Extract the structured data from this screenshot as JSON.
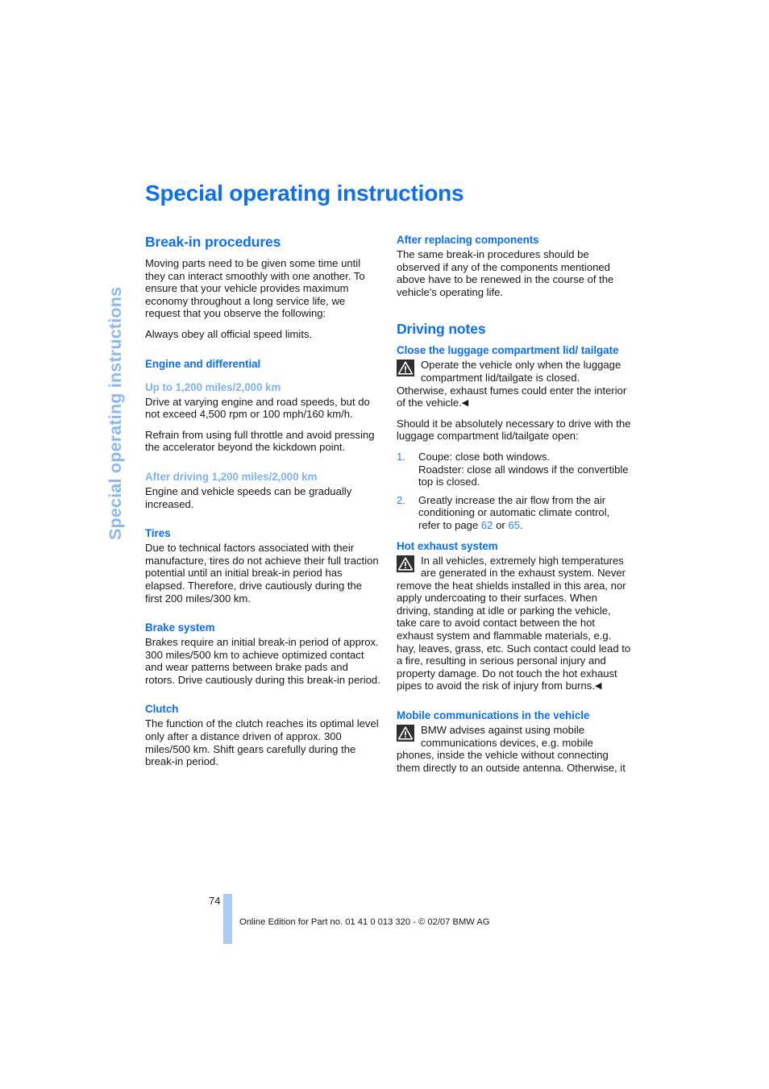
{
  "sidebar": {
    "chapter_label": "Special operating instructions"
  },
  "header": {
    "title": "Special operating instructions"
  },
  "left_column": {
    "section_title": "Break-in procedures",
    "intro_paragraph": "Moving parts need to be given some time until they can interact smoothly with one another. To ensure that your vehicle provides maximum economy throughout a long service life, we request that you observe the following:",
    "speed_limits_paragraph": "Always obey all official speed limits.",
    "engine_heading": "Engine and differential",
    "upto_heading": "Up to 1,200 miles/2,000 km",
    "upto_paragraph_1": "Drive at varying engine and road speeds, but do not exceed 4,500 rpm or 100 mph/160 km/h.",
    "upto_paragraph_2": "Refrain from using full throttle and avoid pressing the accelerator beyond the kickdown point.",
    "after_heading": "After driving 1,200 miles/2,000 km",
    "after_paragraph": "Engine and vehicle speeds can be gradually increased.",
    "tires_heading": "Tires",
    "tires_paragraph": "Due to technical factors associated with their manufacture, tires do not achieve their full traction potential until an initial break-in period has elapsed. Therefore, drive cautiously during the first 200 miles/300 km.",
    "brake_heading": "Brake system",
    "brake_paragraph": "Brakes require an initial break-in period of approx. 300 miles/500 km to achieve optimized contact and wear patterns between brake pads and rotors. Drive cautiously during this break-in period.",
    "clutch_heading": "Clutch",
    "clutch_paragraph": "The function of the clutch reaches its optimal level only after a distance driven of approx. 300 miles/500 km. Shift gears carefully during the break-in period."
  },
  "right_column": {
    "replacing_heading": "After replacing components",
    "replacing_paragraph": "The same break-in procedures should be observed if any of the components mentioned above have to be renewed in the course of the vehicle's operating life.",
    "driving_notes_title": "Driving notes",
    "luggage_heading": "Close the luggage compartment lid/ tailgate",
    "luggage_warning": "Operate the vehicle only when the luggage compartment lid/tailgate is closed. Otherwise, exhaust fumes could enter the interior of the vehicle.",
    "luggage_lead": "Should it be absolutely necessary to drive with the luggage compartment lid/tailgate open:",
    "list": [
      {
        "number": "1.",
        "text": "Coupe: close both windows.\nRoadster: close all windows if the convertible top is closed."
      },
      {
        "number": "2.",
        "text_before": "Greatly increase the air flow from the air conditioning or automatic climate control, refer to page ",
        "link_1": "62",
        "text_between": " or ",
        "link_2": "65",
        "text_after": "."
      }
    ],
    "exhaust_heading": "Hot exhaust system",
    "exhaust_warning": "In all vehicles, extremely high temperatures are generated in the exhaust system. Never remove the heat shields installed in this area, nor apply undercoating to their surfaces. When driving, standing at idle or parking the vehicle, take care to avoid contact between the hot exhaust system and flammable materials, e.g. hay, leaves, grass, etc. Such contact could lead to a fire, resulting in serious personal injury and property damage. Do not touch the hot exhaust pipes to avoid the risk of injury from burns.",
    "mobile_heading": "Mobile communications in the vehicle",
    "mobile_warning": "BMW advises against using mobile communications devices, e.g. mobile phones, inside the vehicle without connecting them directly to an outside antenna. Otherwise, it"
  },
  "footer": {
    "page_number": "74",
    "edition_note": "Online Edition for Part no. 01 41 0 013 320 - © 02/07 BMW AG"
  },
  "icons": {
    "warning": "warning-triangle-icon",
    "end_marker": "◀"
  },
  "colors": {
    "heading_blue": "#0b6ef5",
    "sub_blue": "#7fb2f0",
    "side_tab_blue": "#8ab8f2",
    "link_blue": "#2d7ff0",
    "folio_bar": "#aacbf5",
    "text": "#16181a"
  }
}
